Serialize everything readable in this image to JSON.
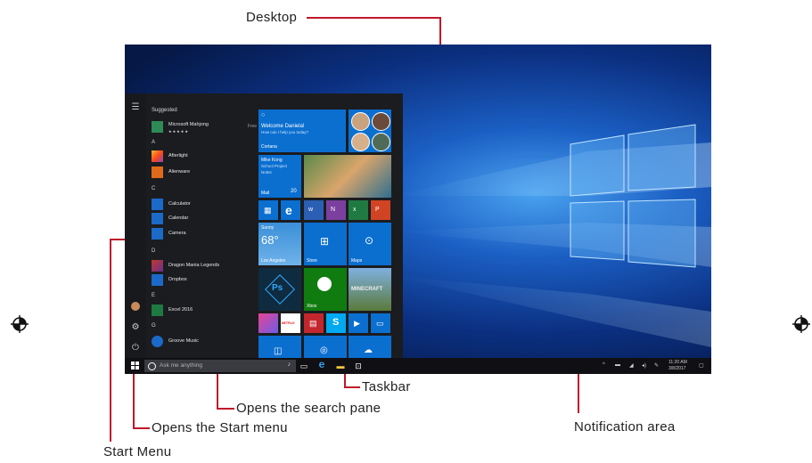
{
  "labels": {
    "desktop": "Desktop",
    "taskbar": "Taskbar",
    "search": "Opens the search pane",
    "start": "Opens the Start menu",
    "notification": "Notification area",
    "start_menu": "Start Menu"
  },
  "colors": {
    "leader": "#c0182a",
    "tile_blue": "#0b6fd0",
    "taskbar": "#101014"
  },
  "start_menu": {
    "suggested_header": "Suggested",
    "suggested_app": {
      "name": "Microsoft Mahjong",
      "rating": "★★★★★",
      "price": "Free"
    },
    "groups": [
      {
        "letter": "A",
        "apps": [
          "Afterlight",
          "Alienware"
        ]
      },
      {
        "letter": "C",
        "apps": [
          "Calculator",
          "Calendar",
          "Camera"
        ]
      },
      {
        "letter": "D",
        "apps": [
          "Dragon Mania Legends",
          "Dropbox"
        ]
      },
      {
        "letter": "E",
        "apps": [
          "Excel 2016"
        ]
      },
      {
        "letter": "G",
        "apps": [
          "Groove Music"
        ]
      }
    ]
  },
  "tiles": {
    "cortana_title": "Welcome Daniela!",
    "cortana_sub": "How can I help you today?",
    "cortana_name": "Cortana",
    "mail_from": "Mike Kong",
    "mail_subject": "School Project",
    "mail_note": "Notes",
    "mail_label": "Mail",
    "mail_count": "20",
    "weather_cond": "Sunny",
    "weather_temp": "68°",
    "weather_city": "Los Angeles",
    "store": "Store",
    "maps": "Maps",
    "xbox": "Xbox",
    "netflix": "NETFLIX",
    "minecraft": "MINECRAFT"
  },
  "taskbar": {
    "search_placeholder": "Ask me anything",
    "time": "11:20 AM",
    "date": "3/8/2017"
  }
}
